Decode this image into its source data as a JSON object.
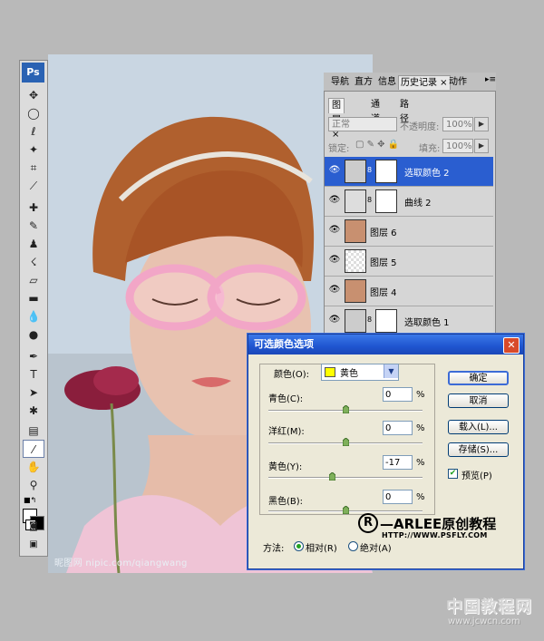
{
  "toolbox": {
    "app_badge": "Ps"
  },
  "canvas": {
    "watermark": "昵图网 nipic.com/qiangwang"
  },
  "panel": {
    "top_tabs": [
      "导航",
      "直方",
      "信息",
      "历史记录 ×",
      "动作"
    ],
    "layer_tabs": [
      "图层 ×",
      "通道",
      "路径"
    ],
    "blend_mode": "正常",
    "opacity_label": "不透明度:",
    "opacity_value": "100%",
    "lock_label": "锁定:",
    "fill_label": "填充:",
    "fill_value": "100%",
    "layers": [
      {
        "name": "选取颜色 2",
        "selected": true
      },
      {
        "name": "曲线 2",
        "selected": false
      },
      {
        "name": "图层 6",
        "selected": false
      },
      {
        "name": "图层 5",
        "selected": false
      },
      {
        "name": "图层 4",
        "selected": false
      },
      {
        "name": "选取颜色 1",
        "selected": false
      }
    ]
  },
  "dialog": {
    "title": "可选颜色选项",
    "colors_label": "颜色(O):",
    "colors_value": "黄色",
    "swatch_color": "#ffff00",
    "sliders": [
      {
        "label": "青色(C):",
        "value": "0",
        "unit": "%",
        "level": 0
      },
      {
        "label": "洋红(M):",
        "value": "0",
        "unit": "%",
        "level": 0
      },
      {
        "label": "黄色(Y):",
        "value": "-17",
        "unit": "%",
        "level": -17
      },
      {
        "label": "黑色(B):",
        "value": "0",
        "unit": "%",
        "level": 0
      }
    ],
    "buttons": {
      "ok": "确定",
      "cancel": "取消",
      "load": "载入(L)...",
      "save": "存储(S)..."
    },
    "preview_label": "预览(P)",
    "preview_checked": true,
    "method_label": "方法:",
    "relative_label": "相对(R)",
    "absolute_label": "绝对(A)",
    "method_selected": "relative"
  },
  "logo": {
    "mark": "R",
    "text": "—ARLEE原创教程",
    "url": "HTTP://WWW.PSFLY.COM"
  },
  "site_watermark": {
    "name": "中国教程网",
    "url": "www.jcwcn.com"
  }
}
